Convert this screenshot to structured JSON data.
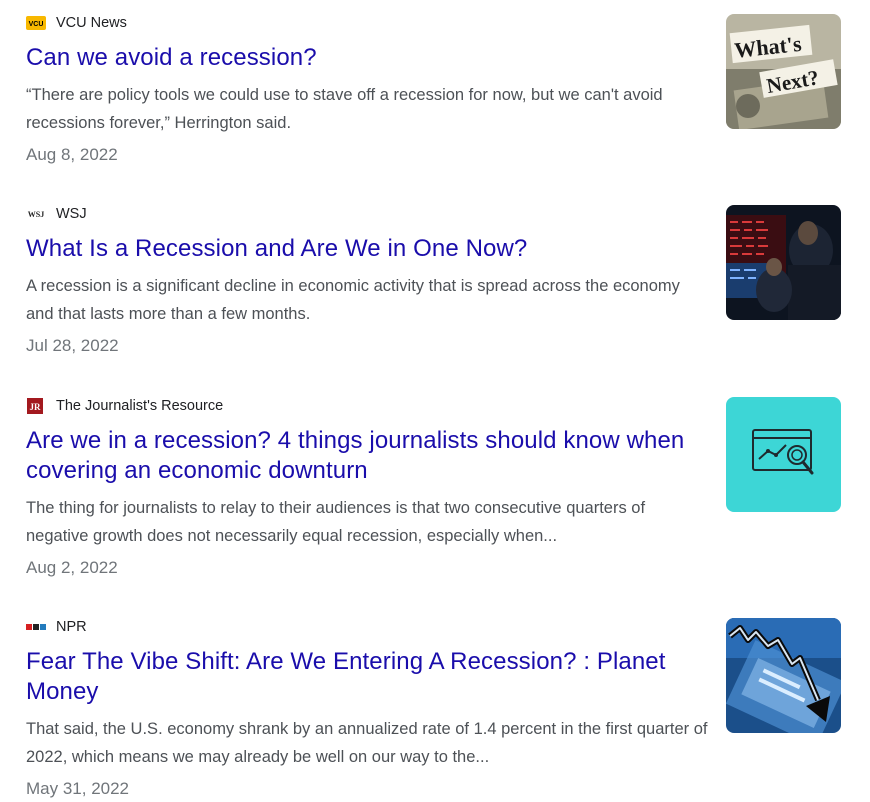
{
  "results": [
    {
      "source": "VCU News",
      "favicon_text": "VCU",
      "title": "Can we avoid a recession?",
      "snippet": "“There are policy tools we could use to stave off a recession for now, but we can't avoid recessions forever,” Herrington said.",
      "date": "Aug 8, 2022",
      "thumbnail_text": [
        "What's",
        "Next?"
      ]
    },
    {
      "source": "WSJ",
      "favicon_text": "WSJ",
      "title": "What Is a Recession and Are We in One Now?",
      "snippet": "A recession is a significant decline in economic activity that is spread across the economy and that lasts more than a few months.",
      "date": "Jul 28, 2022"
    },
    {
      "source": "The Journalist's Resource",
      "favicon_text": "JR",
      "title": "Are we in a recession? 4 things journalists should know when covering an economic downturn",
      "snippet": "The thing for journalists to relay to their audiences is that two consecutive quarters of negative growth does not necessarily equal recession, especially when...",
      "date": "Aug 2, 2022"
    },
    {
      "source": "NPR",
      "favicon_text": "npr",
      "title": "Fear The Vibe Shift: Are We Entering A Recession? : Planet Money",
      "snippet": "That said, the U.S. economy shrank by an annualized rate of 1.4 percent in the first quarter of 2022, which means we may already be well on our way to the...",
      "date": "May 31, 2022"
    }
  ],
  "colors": {
    "title_link": "#1a0dab",
    "snippet": "#4d5156",
    "date": "#70757a",
    "vcu_gold": "#f8b800",
    "jr_red": "#a3191f",
    "teal_thumb": "#3dd6d6"
  },
  "icons": {
    "r1_thumb": "money-whats-next-thumbnail",
    "r2_thumb": "stock-exchange-thumbnail",
    "r3_thumb": "chart-magnifier-icon",
    "r4_thumb": "falling-arrow-thumbnail"
  }
}
